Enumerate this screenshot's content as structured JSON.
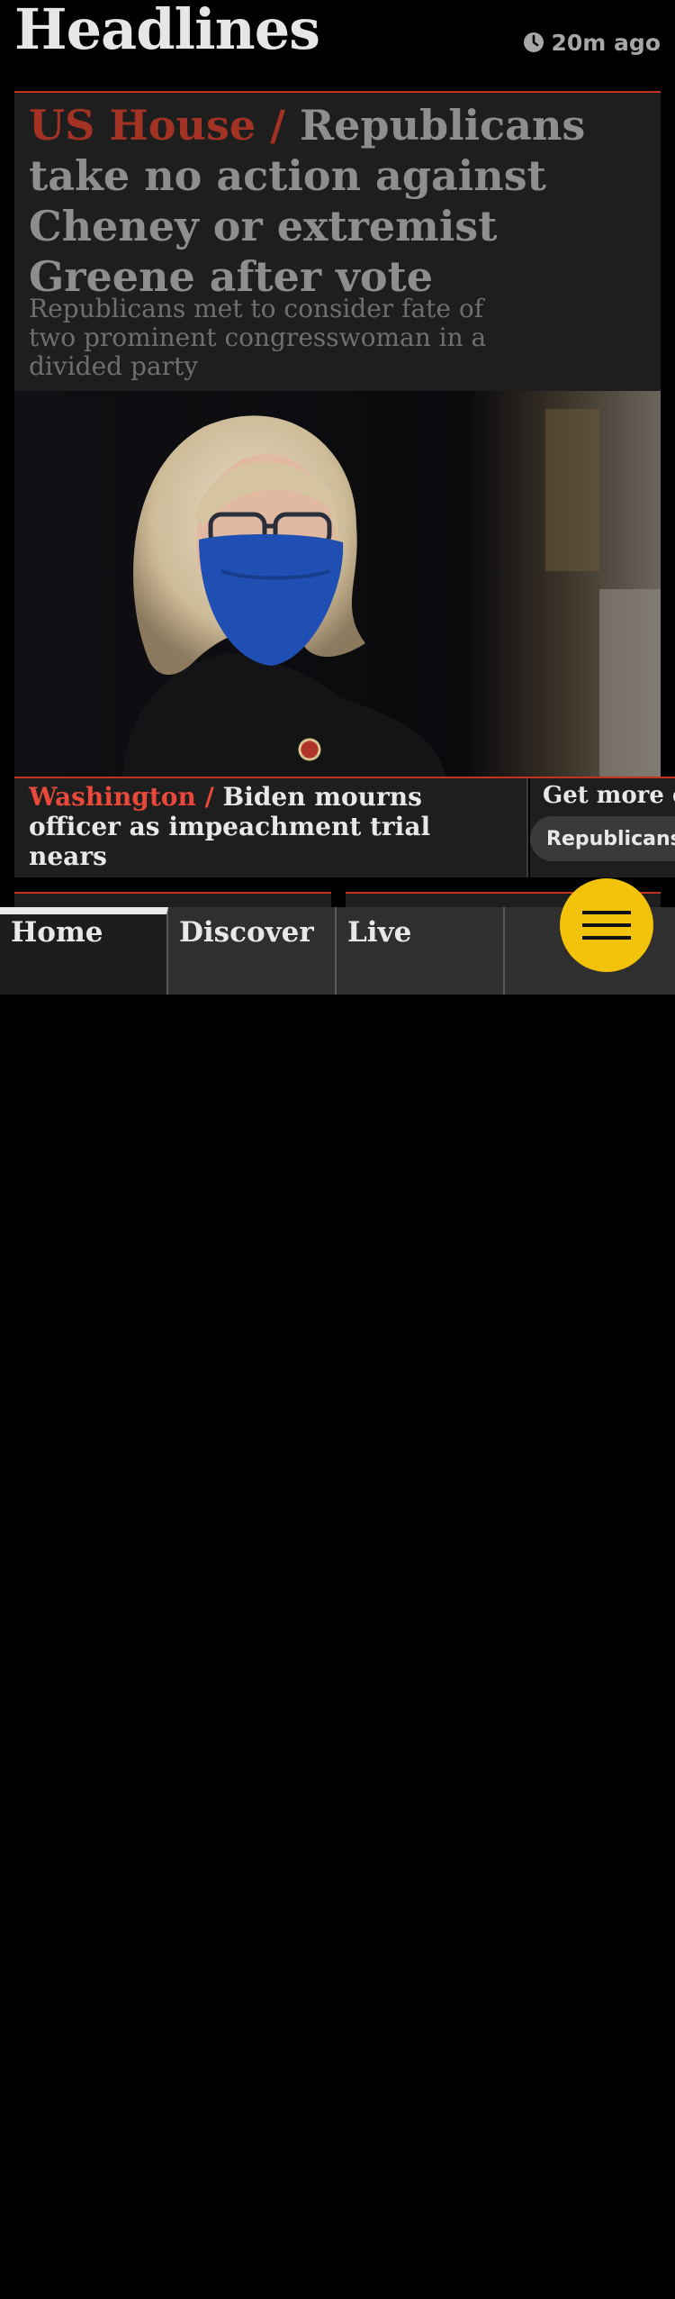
{
  "header": {
    "title": "Headlines",
    "updated": "20m ago"
  },
  "lead": {
    "kicker": "US House /",
    "headline": "Republicans take no action against Cheney or extremist Greene after vote",
    "standfirst": "Republicans met to consider fate of two prominent congresswoman in a divided party"
  },
  "sub_story": {
    "kicker": "Washington /",
    "headline": "Biden mourns officer as impeachment trial nears"
  },
  "more_on": {
    "title": "Get more on",
    "tag": "Republicans"
  },
  "nav": {
    "tabs": [
      {
        "label": "Home"
      },
      {
        "label": "Discover"
      },
      {
        "label": "Live"
      },
      {
        "label": ""
      }
    ],
    "active": "Home"
  },
  "colors": {
    "accent_red": "#c7321e",
    "kicker_red": "#e9493a",
    "menu_yellow": "#f3c30b",
    "card_bg": "#1e1e1e"
  },
  "icons": [
    "clock-icon",
    "hamburger-menu-icon"
  ]
}
